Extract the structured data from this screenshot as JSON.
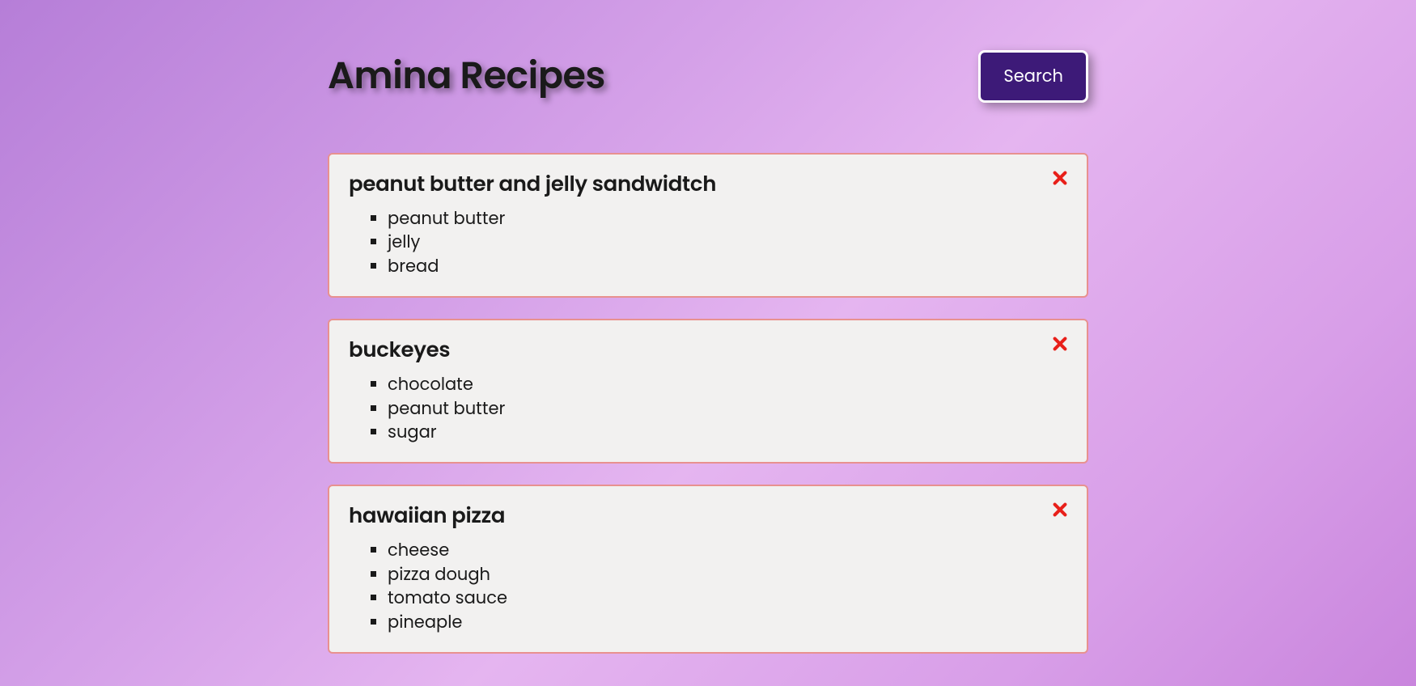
{
  "header": {
    "title": "Amina Recipes",
    "search_label": "Search"
  },
  "recipes": [
    {
      "name": "peanut butter and jelly sandwidtch",
      "ingredients": [
        "peanut butter",
        "jelly",
        "bread"
      ]
    },
    {
      "name": "buckeyes",
      "ingredients": [
        "chocolate",
        "peanut butter",
        "sugar"
      ]
    },
    {
      "name": "hawaiian pizza",
      "ingredients": [
        "cheese",
        "pizza dough",
        "tomato sauce",
        "pineaple"
      ]
    }
  ]
}
